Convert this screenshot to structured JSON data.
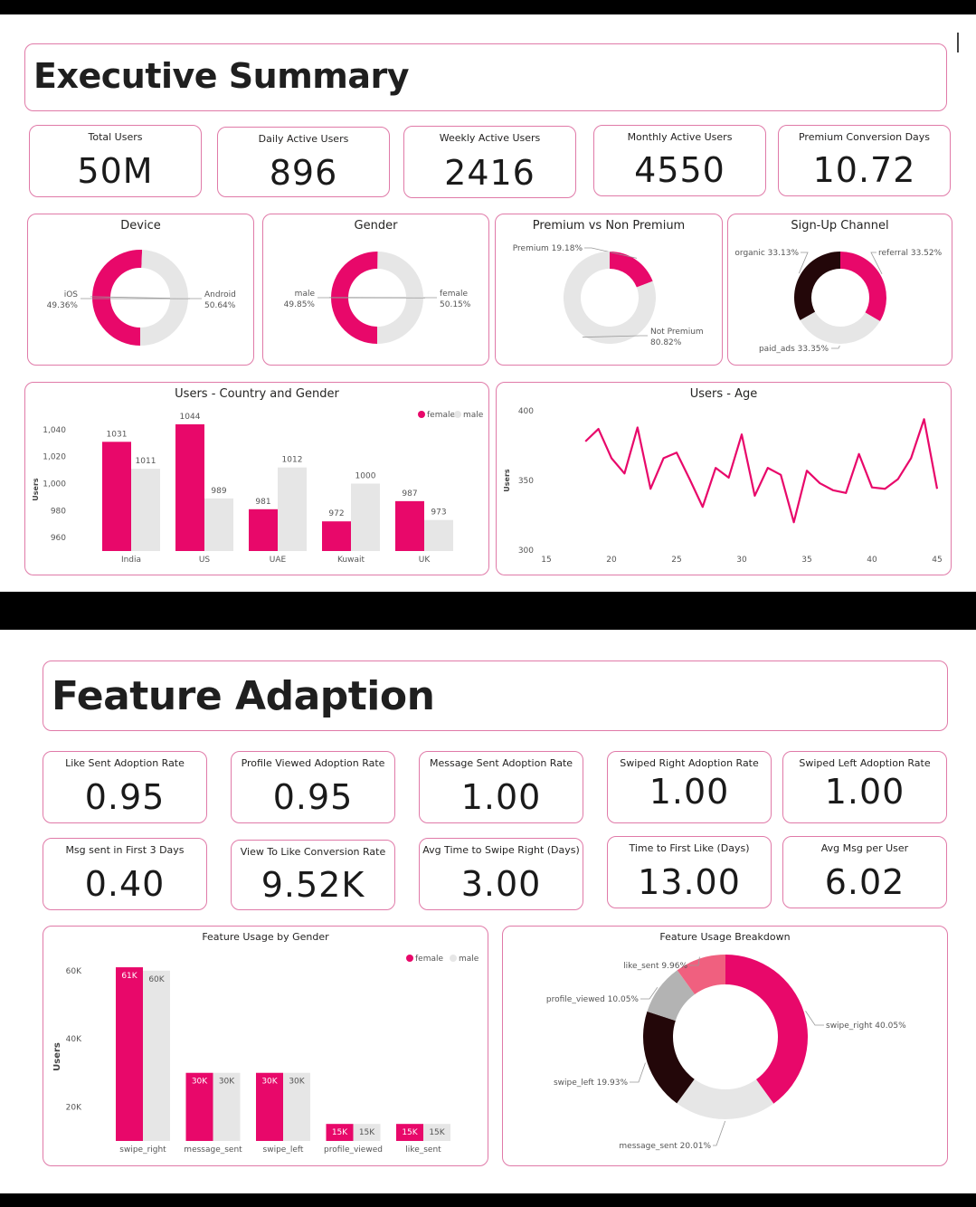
{
  "colors": {
    "pink": "#e8086a",
    "grey": "#e6e6e6",
    "dark": "#230709",
    "light_pink": "#f0607f",
    "mid_grey": "#b3b3b3",
    "border": "#e07aa8"
  },
  "executive": {
    "title": "Executive Summary",
    "kpis": [
      {
        "label": "Total Users",
        "value": "50M"
      },
      {
        "label": "Daily Active Users",
        "value": "896"
      },
      {
        "label": "Weekly Active Users",
        "value": "2416"
      },
      {
        "label": "Monthly Active Users",
        "value": "4550"
      },
      {
        "label": "Premium Conversion Days",
        "value": "10.72"
      }
    ],
    "donut_titles": [
      "Device",
      "Gender",
      "Premium vs Non Premium",
      "Sign-Up Channel"
    ],
    "country_title": "Users - Country and Gender",
    "age_title": "Users - Age"
  },
  "feature": {
    "title": "Feature Adaption",
    "kpis_row1": [
      {
        "label": "Like Sent Adoption Rate",
        "value": "0.95"
      },
      {
        "label": "Profile Viewed Adoption Rate",
        "value": "0.95"
      },
      {
        "label": "Message Sent Adoption Rate",
        "value": "1.00"
      },
      {
        "label": "Swiped Right Adoption Rate",
        "value": "1.00"
      },
      {
        "label": "Swiped Left Adoption Rate",
        "value": "1.00"
      }
    ],
    "kpis_row2": [
      {
        "label": "Msg sent in First 3 Days",
        "value": "0.40"
      },
      {
        "label": "View To Like Conversion Rate",
        "value": "9.52K"
      },
      {
        "label": "Avg Time to Swipe Right (Days)",
        "value": "3.00"
      },
      {
        "label": "Time to First Like (Days)",
        "value": "13.00"
      },
      {
        "label": "Avg Msg per User",
        "value": "6.02"
      }
    ],
    "usage_gender_title": "Feature Usage by Gender",
    "breakdown_title": "Feature Usage Breakdown"
  },
  "chart_data": [
    {
      "type": "pie",
      "title": "Device",
      "donut": true,
      "slices": [
        {
          "label": "Android",
          "value": 50.64,
          "text": "50.64%",
          "color": "#e8086a"
        },
        {
          "label": "iOS",
          "value": 49.36,
          "text": "49.36%",
          "color": "#e6e6e6"
        }
      ]
    },
    {
      "type": "pie",
      "title": "Gender",
      "donut": true,
      "slices": [
        {
          "label": "female",
          "value": 50.15,
          "text": "50.15%",
          "color": "#e8086a"
        },
        {
          "label": "male",
          "value": 49.85,
          "text": "49.85%",
          "color": "#e6e6e6"
        }
      ]
    },
    {
      "type": "pie",
      "title": "Premium vs Non Premium",
      "donut": true,
      "slices": [
        {
          "label": "Premium",
          "value": 19.18,
          "text": "19.18%",
          "color": "#e8086a"
        },
        {
          "label": "Not Premium",
          "value": 80.82,
          "text": "80.82%",
          "color": "#e6e6e6"
        }
      ]
    },
    {
      "type": "pie",
      "title": "Sign-Up Channel",
      "donut": true,
      "slices": [
        {
          "label": "referral",
          "value": 33.52,
          "text": "33.52%",
          "color": "#e8086a"
        },
        {
          "label": "paid_ads",
          "value": 33.35,
          "text": "33.35%",
          "color": "#e6e6e6"
        },
        {
          "label": "organic",
          "value": 33.13,
          "text": "33.13%",
          "color": "#230709"
        }
      ]
    },
    {
      "type": "bar",
      "title": "Users - Country and Gender",
      "ylabel": "Users",
      "categories": [
        "India",
        "US",
        "UAE",
        "Kuwait",
        "UK"
      ],
      "ylim": [
        950,
        1050
      ],
      "yticks": [
        960,
        980,
        1000,
        1020,
        1040
      ],
      "ytick_labels": [
        "960",
        "980",
        "1,000",
        "1,020",
        "1,040"
      ],
      "legend": [
        "female",
        "male"
      ],
      "legend_position": "top-right",
      "series": [
        {
          "name": "female",
          "values": [
            1031,
            1044,
            981,
            972,
            987
          ],
          "color": "#e8086a"
        },
        {
          "name": "male",
          "values": [
            1011,
            989,
            1012,
            1000,
            973
          ],
          "color": "#e6e6e6"
        }
      ]
    },
    {
      "type": "line",
      "title": "Users - Age",
      "ylabel": "Users",
      "x": [
        18,
        19,
        20,
        21,
        22,
        23,
        24,
        25,
        26,
        27,
        28,
        29,
        30,
        31,
        32,
        33,
        34,
        35,
        36,
        37,
        38,
        39,
        40,
        41,
        42,
        43,
        44,
        45
      ],
      "y": [
        378,
        387,
        366,
        355,
        388,
        344,
        366,
        370,
        351,
        331,
        359,
        352,
        383,
        339,
        359,
        354,
        320,
        357,
        348,
        343,
        341,
        369,
        345,
        344,
        351,
        366,
        394,
        344
      ],
      "xlim": [
        15,
        45
      ],
      "xticks": [
        15,
        20,
        25,
        30,
        35,
        40,
        45
      ],
      "ylim": [
        300,
        400
      ],
      "yticks": [
        300,
        350,
        400
      ],
      "color": "#e8086a"
    },
    {
      "type": "bar",
      "title": "Feature Usage by Gender",
      "ylabel": "Users",
      "categories": [
        "swipe_right",
        "message_sent",
        "swipe_left",
        "profile_viewed",
        "like_sent"
      ],
      "ylim": [
        10000,
        65000
      ],
      "yticks": [
        20000,
        40000,
        60000
      ],
      "ytick_labels": [
        "20K",
        "40K",
        "60K"
      ],
      "legend": [
        "female",
        "male"
      ],
      "legend_position": "top-right",
      "series": [
        {
          "name": "female",
          "values": [
            61000,
            30000,
            30000,
            15000,
            15000
          ],
          "labels": [
            "61K",
            "30K",
            "30K",
            "15K",
            "15K"
          ],
          "color": "#e8086a"
        },
        {
          "name": "male",
          "values": [
            60000,
            30000,
            30000,
            15000,
            15000
          ],
          "labels": [
            "60K",
            "30K",
            "30K",
            "15K",
            "15K"
          ],
          "color": "#e6e6e6"
        }
      ]
    },
    {
      "type": "pie",
      "title": "Feature Usage Breakdown",
      "donut": true,
      "slices": [
        {
          "label": "swipe_right",
          "value": 40.05,
          "text": "40.05%",
          "color": "#e8086a"
        },
        {
          "label": "message_sent",
          "value": 20.01,
          "text": "20.01%",
          "color": "#e6e6e6"
        },
        {
          "label": "swipe_left",
          "value": 19.93,
          "text": "19.93%",
          "color": "#230709"
        },
        {
          "label": "profile_viewed",
          "value": 10.05,
          "text": "10.05%",
          "color": "#b3b3b3"
        },
        {
          "label": "like_sent",
          "value": 9.96,
          "text": "9.96%",
          "color": "#f0607f"
        }
      ]
    }
  ]
}
